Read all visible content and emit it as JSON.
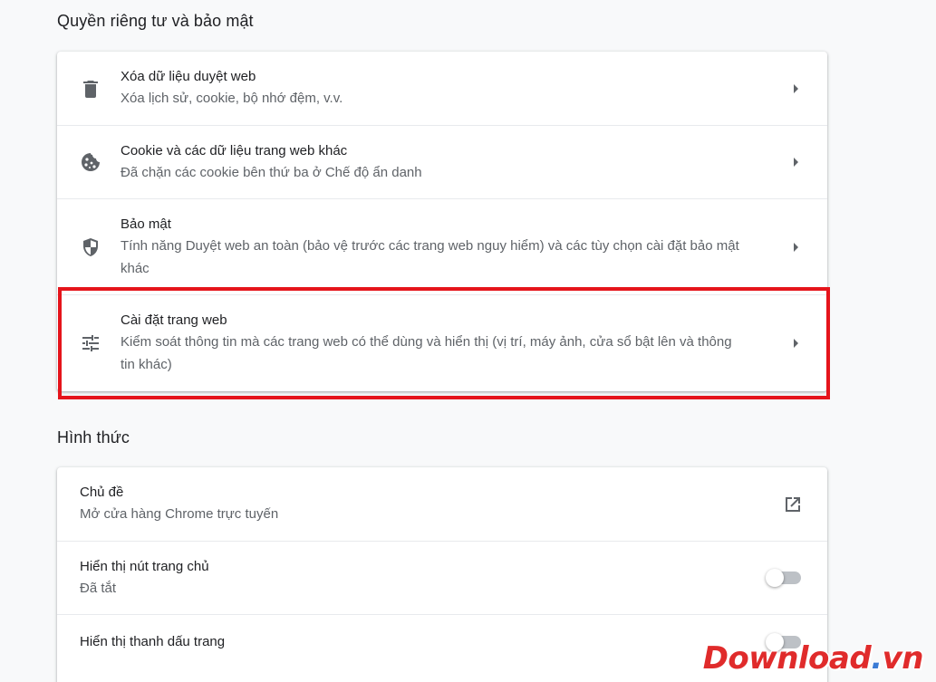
{
  "privacy": {
    "title": "Quyền riêng tư và bảo mật",
    "items": [
      {
        "icon": "trash-icon",
        "label": "Xóa dữ liệu duyệt web",
        "sub": "Xóa lịch sử, cookie, bộ nhớ đệm, v.v."
      },
      {
        "icon": "cookie-icon",
        "label": "Cookie và các dữ liệu trang web khác",
        "sub": "Đã chặn các cookie bên thứ ba ở Chế độ ẩn danh"
      },
      {
        "icon": "shield-icon",
        "label": "Bảo mật",
        "sub": "Tính năng Duyệt web an toàn (bảo vệ trước các trang web nguy hiểm) và các tùy chọn cài đặt bảo mật khác"
      },
      {
        "icon": "tune-icon",
        "label": "Cài đặt trang web",
        "sub": "Kiểm soát thông tin mà các trang web có thể dùng và hiển thị (vị trí, máy ảnh, cửa sổ bật lên và thông tin khác)"
      }
    ]
  },
  "appearance": {
    "title": "Hình thức",
    "items": [
      {
        "label": "Chủ đề",
        "sub": "Mở cửa hàng Chrome trực tuyến",
        "control": "open-in-new-icon"
      },
      {
        "label": "Hiển thị nút trang chủ",
        "sub": "Đã tắt",
        "control": "toggle",
        "enabled": false
      },
      {
        "label": "Hiển thị thanh dấu trang",
        "control": "toggle",
        "enabled": false
      }
    ]
  },
  "watermark": {
    "main": "Download",
    "dot": ".",
    "ext": "vn"
  },
  "colors": {
    "highlight": "#e5141b",
    "icon": "#5f6368",
    "toggle_off": "#bdc1c6"
  }
}
